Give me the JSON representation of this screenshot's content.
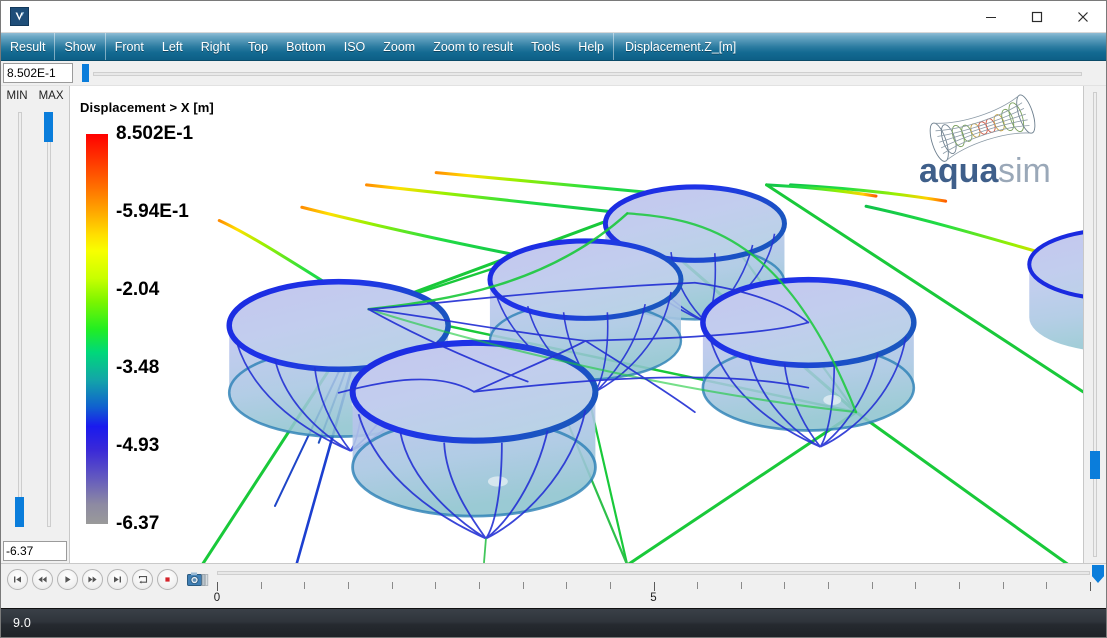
{
  "window": {
    "app_icon": "vessel-app-icon",
    "minimize_label": "Minimize",
    "maximize_label": "Maximize",
    "close_label": "Close"
  },
  "menubar": {
    "groups": [
      {
        "items": [
          {
            "label": "Result",
            "name": "menu-result"
          }
        ]
      },
      {
        "items": [
          {
            "label": "Show",
            "name": "menu-show"
          }
        ]
      },
      {
        "items": [
          {
            "label": "Front",
            "name": "menu-front"
          },
          {
            "label": "Left",
            "name": "menu-left"
          },
          {
            "label": "Right",
            "name": "menu-right"
          },
          {
            "label": "Top",
            "name": "menu-top"
          },
          {
            "label": "Bottom",
            "name": "menu-bottom"
          },
          {
            "label": "ISO",
            "name": "menu-iso"
          },
          {
            "label": "Zoom",
            "name": "menu-zoom"
          },
          {
            "label": "Zoom to result",
            "name": "menu-zoom-to-result"
          },
          {
            "label": "Tools",
            "name": "menu-tools"
          },
          {
            "label": "Help",
            "name": "menu-help"
          }
        ]
      },
      {
        "items": [
          {
            "label": "Displacement.Z_[m]",
            "name": "menu-displacement-z"
          }
        ]
      }
    ]
  },
  "range": {
    "max_value": "8.502E-1",
    "min_value": "-6.37",
    "min_label": "MIN",
    "max_label": "MAX"
  },
  "viewport": {
    "title": "Displacement > X [m]",
    "logo_primary": "aqua",
    "logo_secondary": "sim"
  },
  "chart_data": {
    "type": "heatmap",
    "title": "Displacement > X [m]",
    "colorbar_label": "Displacement > X [m]",
    "unit": "m",
    "ticks": [
      {
        "label": "8.502E-1",
        "value": 0.8502,
        "pos": 0.0
      },
      {
        "label": "-5.94E-1",
        "value": -0.594,
        "pos": 0.2
      },
      {
        "label": "-2.04",
        "value": -2.04,
        "pos": 0.4
      },
      {
        "label": "-3.48",
        "value": -3.48,
        "pos": 0.6
      },
      {
        "label": "-4.93",
        "value": -4.93,
        "pos": 0.8
      },
      {
        "label": "-6.37",
        "value": -6.37,
        "pos": 1.0
      }
    ],
    "range": [
      -6.37,
      0.8502
    ],
    "colormap": [
      "#ff0000",
      "#ffa800",
      "#f8ff00",
      "#22ee22",
      "#13a5a8",
      "#1a1aee",
      "#6258c0",
      "#9a9a9a"
    ],
    "legend_position": "left",
    "grid": false,
    "xlabel": "",
    "ylabel": ""
  },
  "player": {
    "buttons": [
      {
        "name": "skip-to-start-button",
        "icon": "skip-start-icon"
      },
      {
        "name": "rewind-button",
        "icon": "rewind-icon"
      },
      {
        "name": "play-button",
        "icon": "play-icon"
      },
      {
        "name": "fast-forward-button",
        "icon": "fast-forward-icon"
      },
      {
        "name": "skip-to-end-button",
        "icon": "skip-end-icon"
      },
      {
        "name": "loop-button",
        "icon": "loop-icon"
      },
      {
        "name": "record-button",
        "icon": "record-icon"
      }
    ],
    "camera_button": {
      "name": "screenshot-button",
      "icon": "camera-icon"
    },
    "timeline": {
      "labels": [
        {
          "text": "0",
          "pos": 0.0
        },
        {
          "text": "5",
          "pos": 0.5
        }
      ],
      "tick_count": 21,
      "thumb_pos": 1.0
    }
  },
  "statusbar": {
    "text": "9.0"
  }
}
